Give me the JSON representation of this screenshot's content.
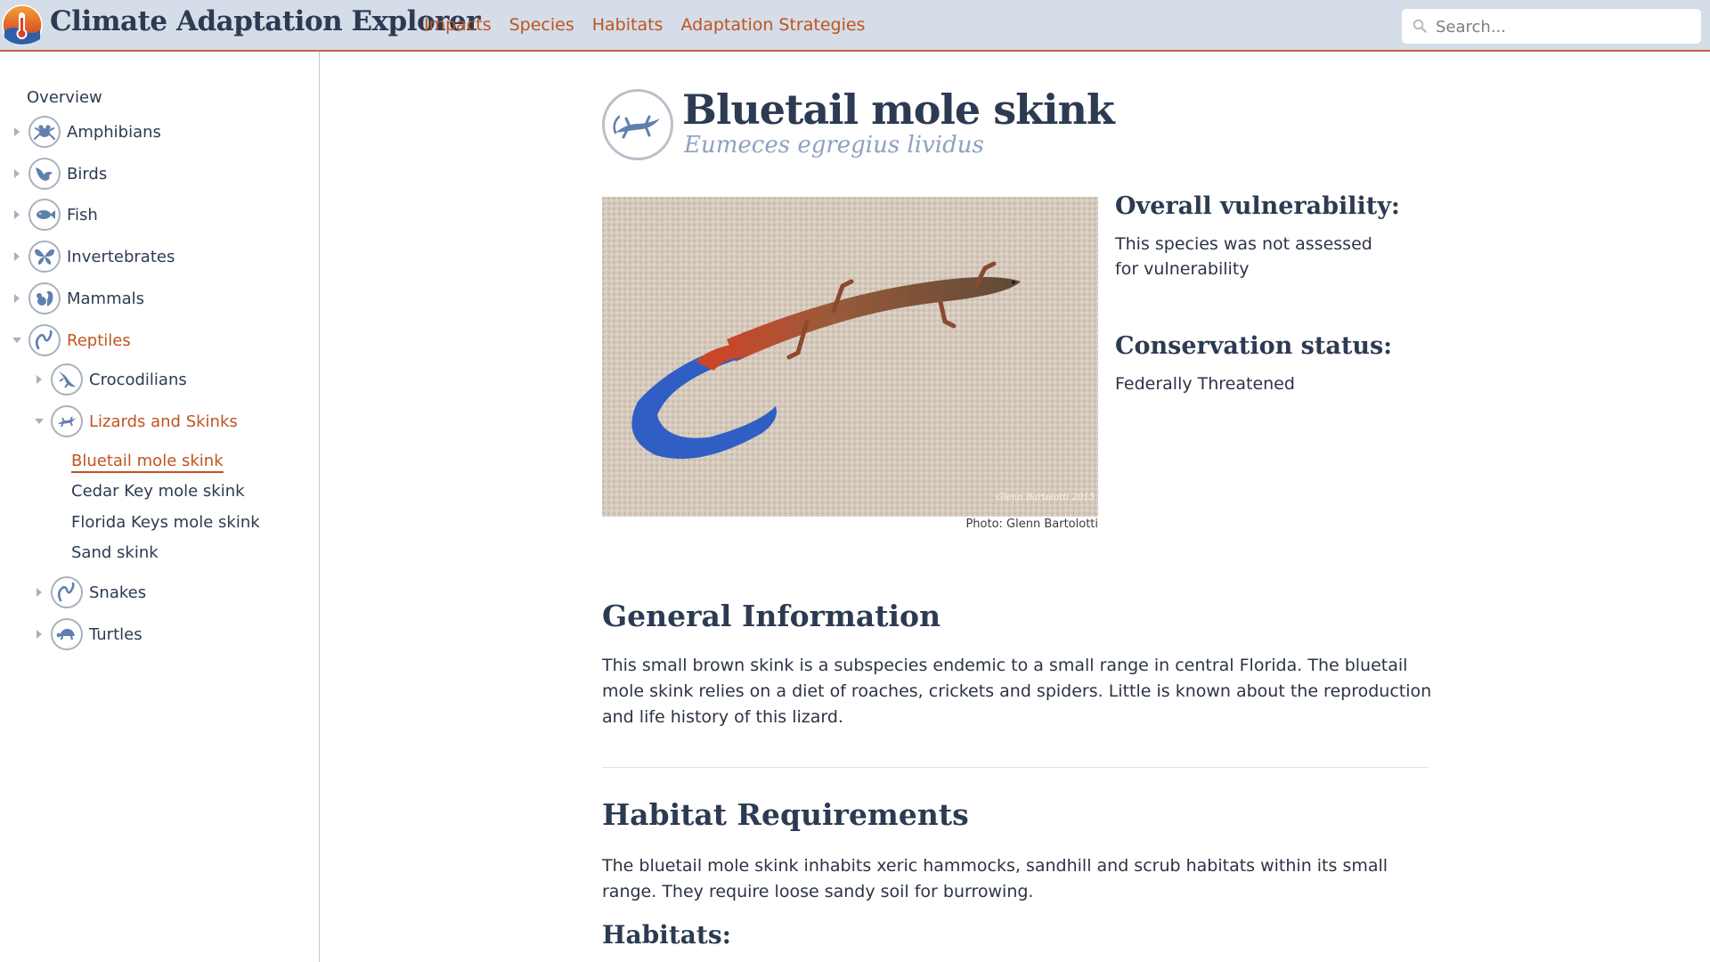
{
  "header": {
    "app_title": "Climate Adaptation Explorer",
    "nav": [
      "Impacts",
      "Species",
      "Habitats",
      "Adaptation Strategies"
    ],
    "search_placeholder": "Search..."
  },
  "sidebar": {
    "overview": "Overview",
    "groups": [
      {
        "label": "Amphibians",
        "icon": "frog-icon",
        "expanded": false
      },
      {
        "label": "Birds",
        "icon": "bird-icon",
        "expanded": false
      },
      {
        "label": "Fish",
        "icon": "fish-icon",
        "expanded": false
      },
      {
        "label": "Invertebrates",
        "icon": "butterfly-icon",
        "expanded": false
      },
      {
        "label": "Mammals",
        "icon": "squirrel-icon",
        "expanded": false
      },
      {
        "label": "Reptiles",
        "icon": "snake-icon",
        "expanded": true
      }
    ],
    "reptile_subgroups": [
      {
        "label": "Crocodilians",
        "icon": "crocodile-icon",
        "expanded": false
      },
      {
        "label": "Lizards and Skinks",
        "icon": "lizard-icon",
        "expanded": true
      },
      {
        "label": "Snakes",
        "icon": "snake-icon",
        "expanded": false
      },
      {
        "label": "Turtles",
        "icon": "turtle-icon",
        "expanded": false
      }
    ],
    "lizard_species": [
      "Bluetail mole skink",
      "Cedar Key mole skink",
      "Florida Keys mole skink",
      "Sand skink"
    ],
    "current_species": "Bluetail mole skink"
  },
  "species": {
    "common_name": "Bluetail mole skink",
    "scientific_name": "Eumeces egregius lividus",
    "photo_credit": "Photo: Glenn Bartolotti",
    "photo_watermark": "Glenn Bartolotti 2015",
    "vulnerability_heading": "Overall vulnerability:",
    "vulnerability_text": "This species was not assessed for vulnerability",
    "conservation_heading": "Conservation status:",
    "conservation_text": "Federally Threatened",
    "general_heading": "General Information",
    "general_text": "This small brown skink is a subspecies endemic to a small range in central Florida. The bluetail mole skink relies on a diet of roaches, crickets and spiders. Little is known about the reproduction and life history of this lizard.",
    "habitat_heading": "Habitat Requirements",
    "habitat_text": "The bluetail mole skink inhabits xeric hammocks, sandhill and scrub habitats within its small range. They require loose sandy soil for burrowing.",
    "habitats_heading": "Habitats:"
  },
  "colors": {
    "accent": "#c2531f",
    "heading": "#2c3b52",
    "header_bg": "#d4dde8",
    "icon_blue": "#5f7fae"
  }
}
